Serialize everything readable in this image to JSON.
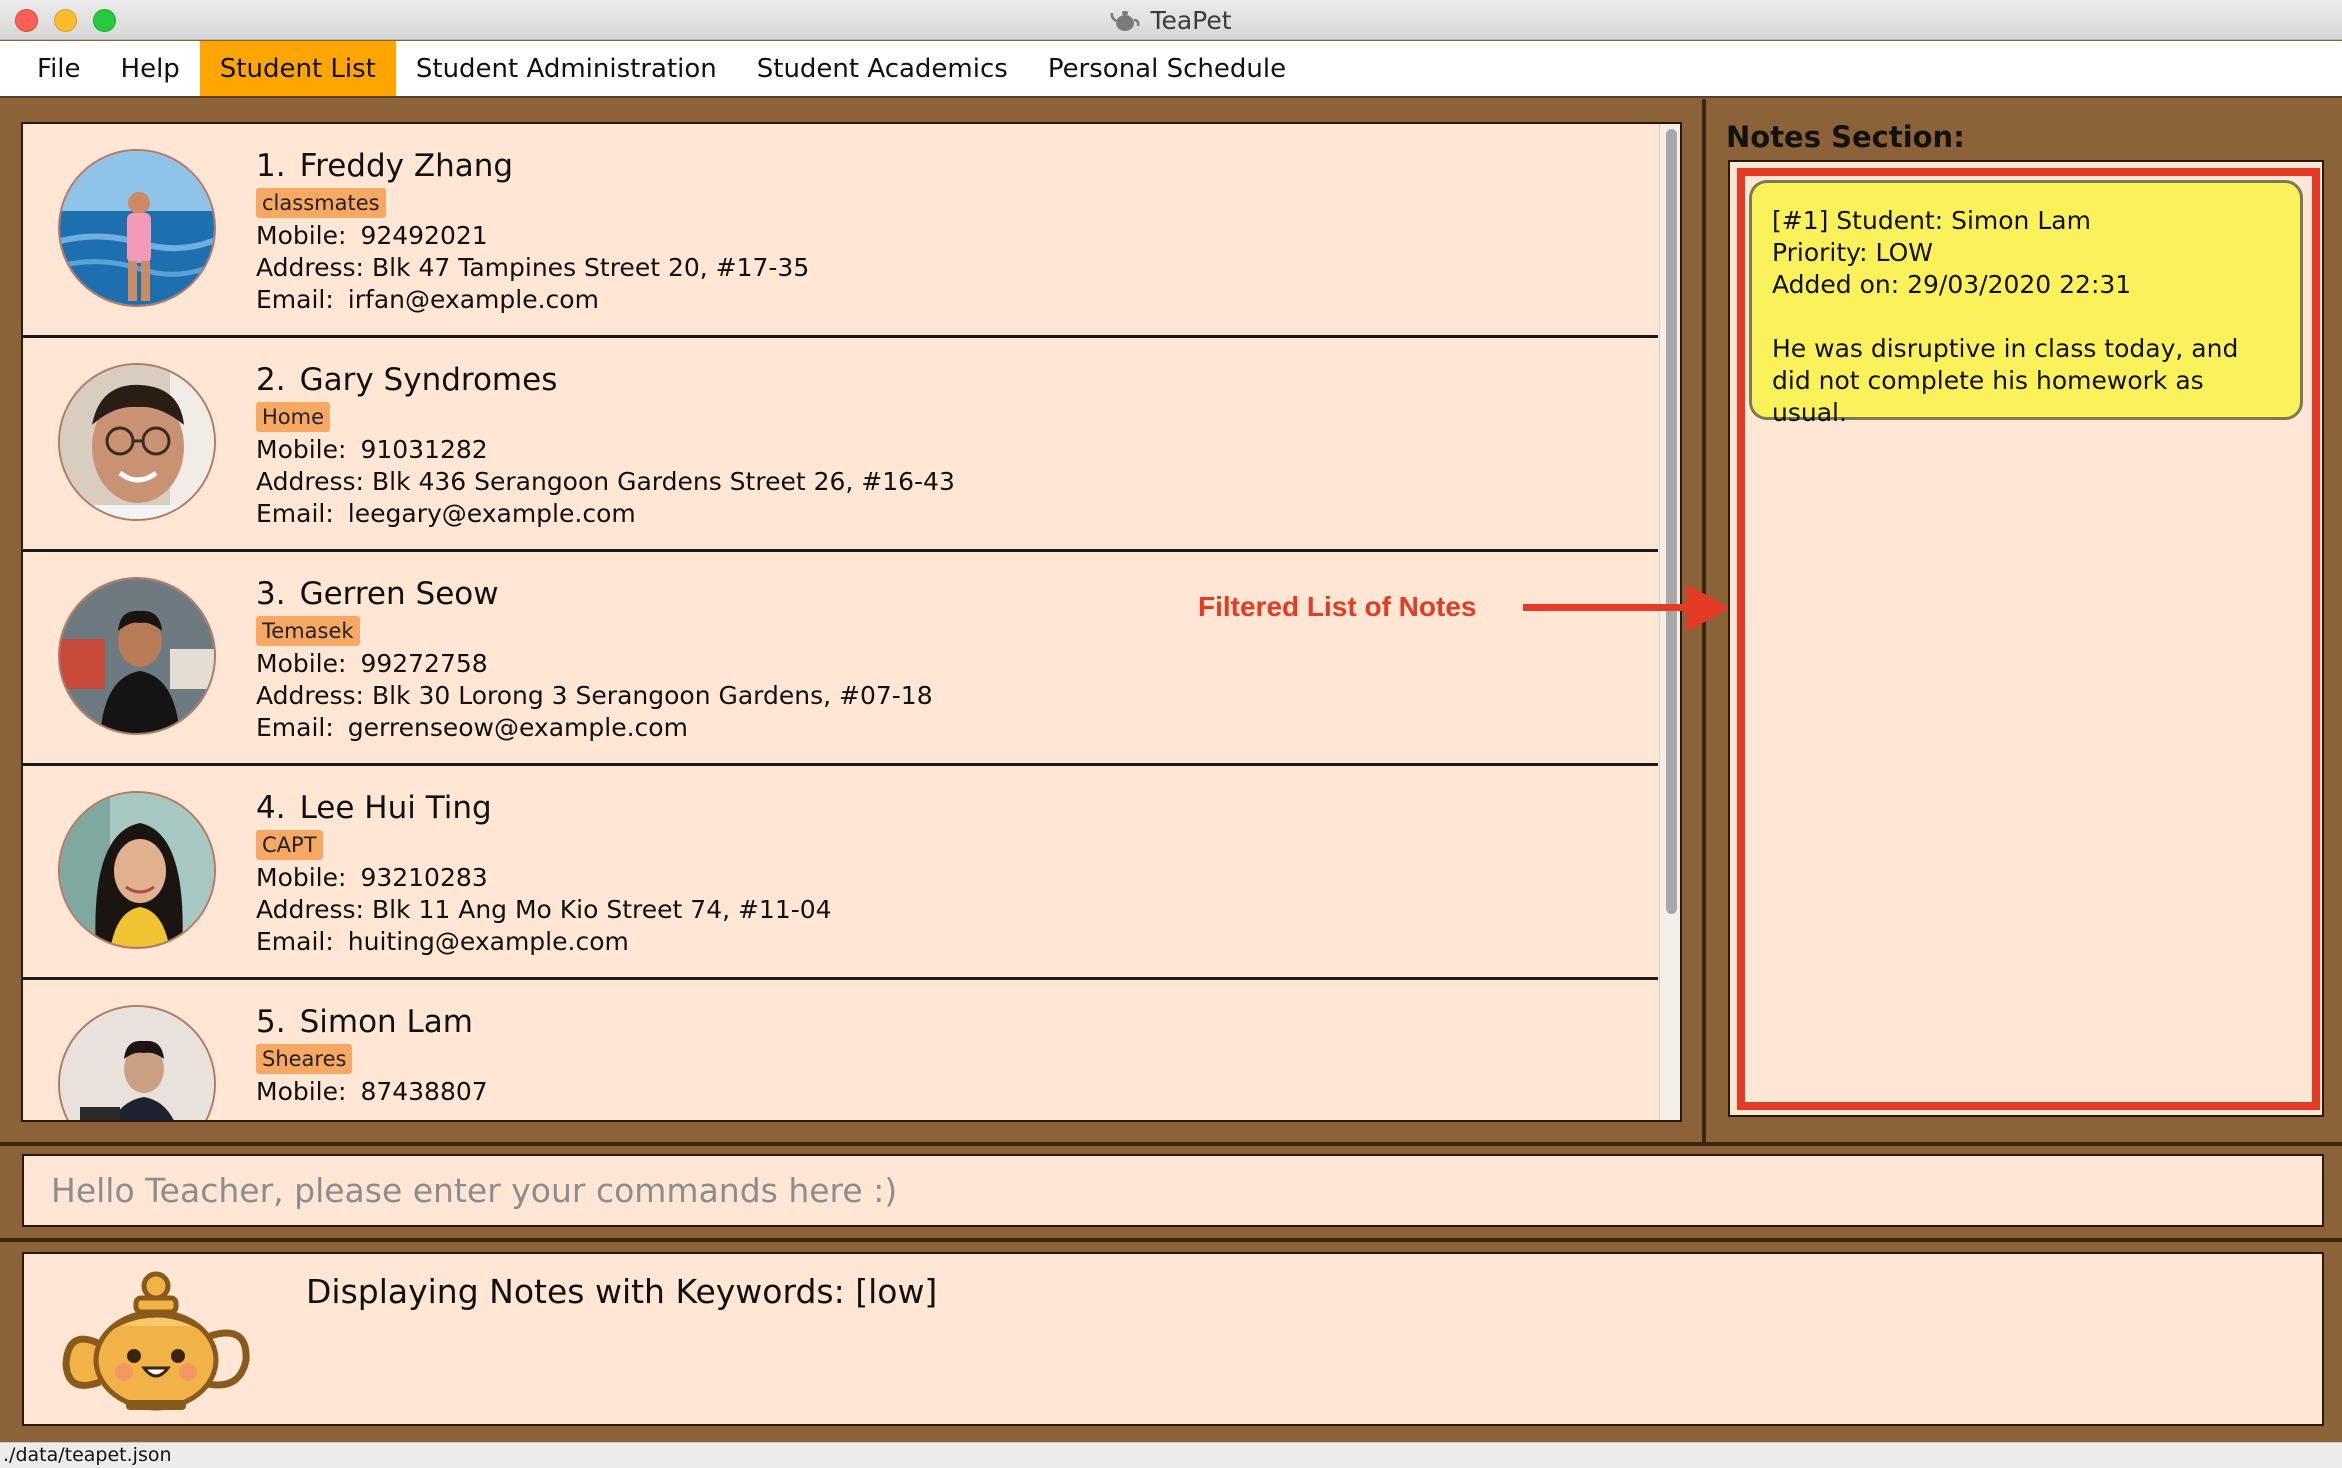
{
  "window": {
    "title": "TeaPet"
  },
  "menu": {
    "items": [
      {
        "label": "File"
      },
      {
        "label": "Help"
      },
      {
        "label": "Student List",
        "active": true
      },
      {
        "label": "Student Administration"
      },
      {
        "label": "Student Academics"
      },
      {
        "label": "Personal Schedule"
      }
    ]
  },
  "students": [
    {
      "index": "1.",
      "name": "Freddy Zhang",
      "tag": "classmates",
      "mobile_label": "Mobile:",
      "mobile": "92492021",
      "address_label": "Address:",
      "address": "Blk 47 Tampines Street 20, #17-35",
      "email_label": "Email:",
      "email": "irfan@example.com"
    },
    {
      "index": "2.",
      "name": "Gary Syndromes",
      "tag": "Home",
      "mobile_label": "Mobile:",
      "mobile": "91031282",
      "address_label": "Address:",
      "address": "Blk 436 Serangoon Gardens Street 26, #16-43",
      "email_label": "Email:",
      "email": "leegary@example.com"
    },
    {
      "index": "3.",
      "name": "Gerren Seow",
      "tag": "Temasek",
      "mobile_label": "Mobile:",
      "mobile": "99272758",
      "address_label": "Address:",
      "address": "Blk 30 Lorong 3 Serangoon Gardens, #07-18",
      "email_label": "Email:",
      "email": "gerrenseow@example.com"
    },
    {
      "index": "4.",
      "name": "Lee Hui Ting",
      "tag": "CAPT",
      "mobile_label": "Mobile:",
      "mobile": "93210283",
      "address_label": "Address:",
      "address": "Blk 11 Ang Mo Kio Street 74, #11-04",
      "email_label": "Email:",
      "email": "huiting@example.com"
    },
    {
      "index": "5.",
      "name": "Simon Lam",
      "tag": "Sheares",
      "mobile_label": "Mobile:",
      "mobile": "87438807"
    }
  ],
  "notes": {
    "title": "Notes Section:",
    "items": [
      {
        "header": "[#1] Student: Simon Lam",
        "priority": "Priority: LOW",
        "added": "Added on: 29/03/2020 22:31",
        "body": "He was disruptive in class today, and did not complete his homework as usual."
      }
    ]
  },
  "annotation": {
    "text": "Filtered List of Notes",
    "color": "#e53b24"
  },
  "command": {
    "placeholder": "Hello Teacher, please enter your commands here :)"
  },
  "result": {
    "text": "Displaying Notes with Keywords: [low]"
  },
  "status": {
    "path": "./data/teapet.json"
  },
  "colors": {
    "accent": "#ffa500",
    "panel": "#ffe6d5",
    "frame": "#8c6239",
    "tag": "#f7a863",
    "note": "#fbf15b",
    "highlight": "#e53b24"
  }
}
